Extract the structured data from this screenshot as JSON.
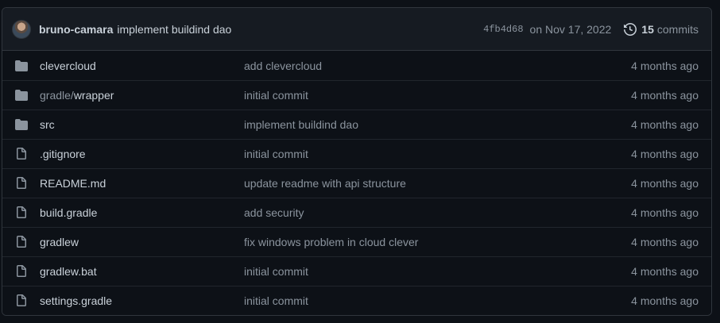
{
  "latest_commit": {
    "author": "bruno-camara",
    "message": "implement buildind dao",
    "sha": "4fb4d68",
    "date": "on Nov 17, 2022",
    "commits_count": "15",
    "commits_label": "commits"
  },
  "files": [
    {
      "type": "dir",
      "prefix": "",
      "name": "clevercloud",
      "commit": "add clevercloud",
      "age": "4 months ago"
    },
    {
      "type": "dir",
      "prefix": "gradle/",
      "name": "wrapper",
      "commit": "initial commit",
      "age": "4 months ago"
    },
    {
      "type": "dir",
      "prefix": "",
      "name": "src",
      "commit": "implement buildind dao",
      "age": "4 months ago"
    },
    {
      "type": "file",
      "prefix": "",
      "name": ".gitignore",
      "commit": "initial commit",
      "age": "4 months ago"
    },
    {
      "type": "file",
      "prefix": "",
      "name": "README.md",
      "commit": "update readme with api structure",
      "age": "4 months ago"
    },
    {
      "type": "file",
      "prefix": "",
      "name": "build.gradle",
      "commit": "add security",
      "age": "4 months ago"
    },
    {
      "type": "file",
      "prefix": "",
      "name": "gradlew",
      "commit": "fix windows problem in cloud clever",
      "age": "4 months ago"
    },
    {
      "type": "file",
      "prefix": "",
      "name": "gradlew.bat",
      "commit": "initial commit",
      "age": "4 months ago"
    },
    {
      "type": "file",
      "prefix": "",
      "name": "settings.gradle",
      "commit": "initial commit",
      "age": "4 months ago"
    }
  ],
  "icons": {
    "dir": "folder-icon",
    "file": "file-icon",
    "history": "history-icon"
  },
  "colors": {
    "background": "#0d1117",
    "header": "#161b22",
    "border": "#30363d",
    "muted": "#8b949e",
    "text": "#c9d1d9"
  }
}
